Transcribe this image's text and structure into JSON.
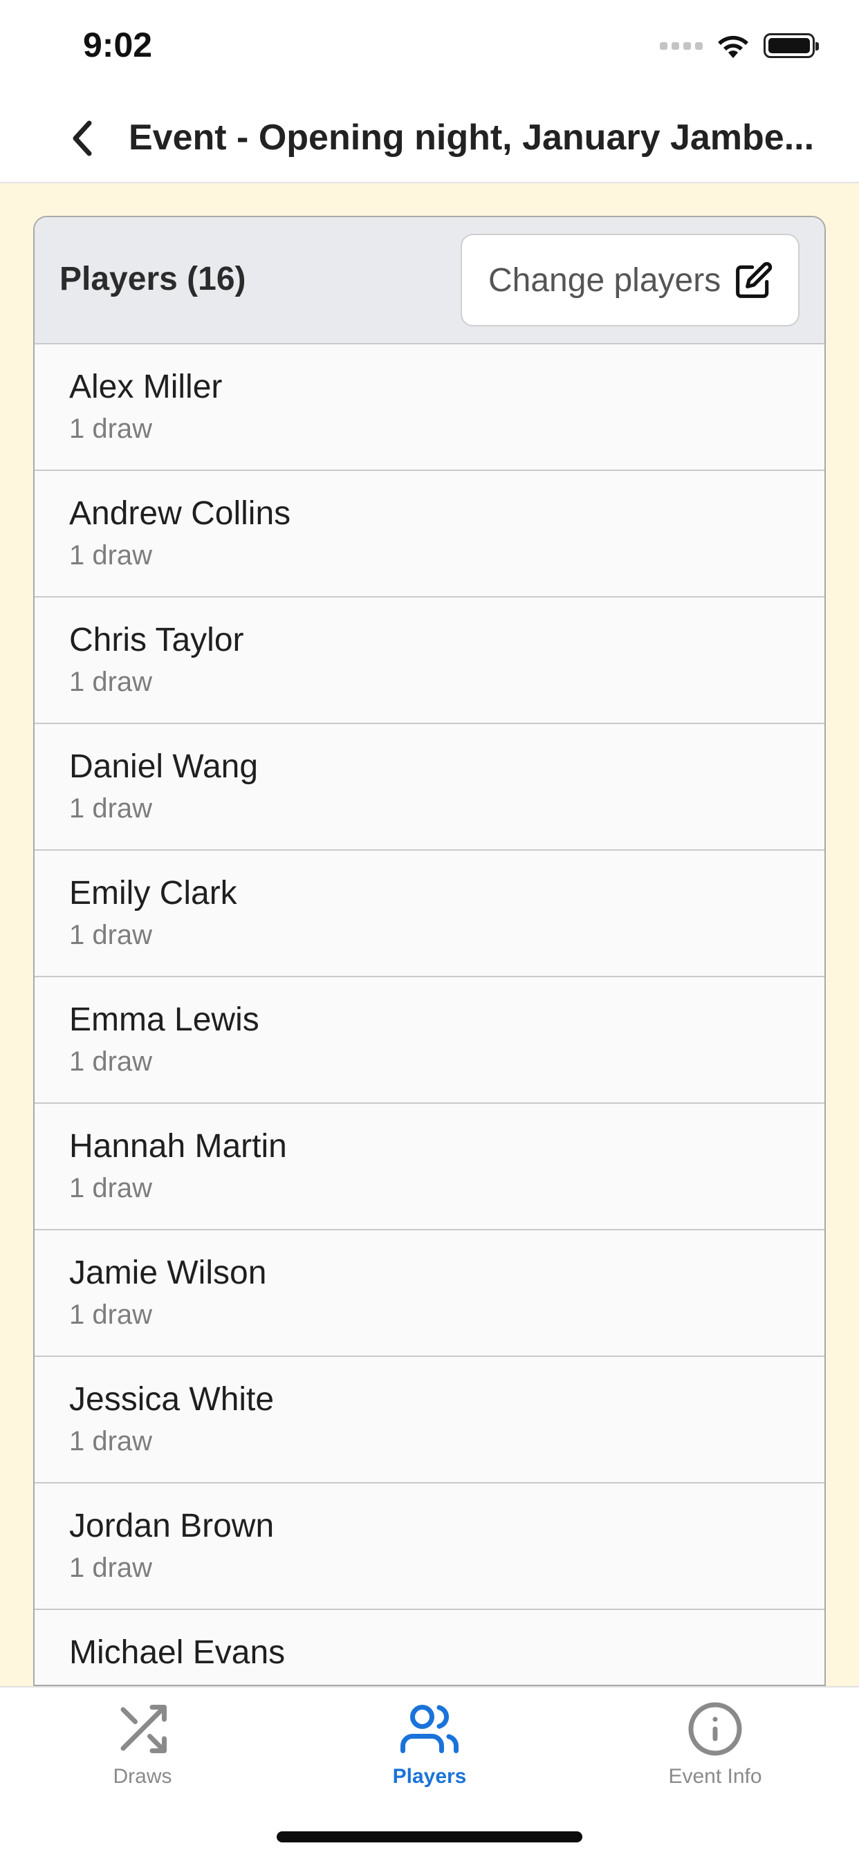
{
  "status_bar": {
    "time": "9:02"
  },
  "nav": {
    "title": "Event  -  Opening night, January Jambe..."
  },
  "players_card": {
    "title": "Players (16)",
    "change_players_label": "Change players"
  },
  "players": [
    {
      "name": "Alex Miller",
      "draws": "1 draw"
    },
    {
      "name": "Andrew Collins",
      "draws": "1 draw"
    },
    {
      "name": "Chris Taylor",
      "draws": "1 draw"
    },
    {
      "name": "Daniel Wang",
      "draws": "1 draw"
    },
    {
      "name": "Emily Clark",
      "draws": "1 draw"
    },
    {
      "name": "Emma Lewis",
      "draws": "1 draw"
    },
    {
      "name": "Hannah Martin",
      "draws": "1 draw"
    },
    {
      "name": "Jamie Wilson",
      "draws": "1 draw"
    },
    {
      "name": "Jessica White",
      "draws": "1 draw"
    },
    {
      "name": "Jordan Brown",
      "draws": "1 draw"
    },
    {
      "name": "Michael Evans",
      "draws": ""
    }
  ],
  "tabs": [
    {
      "label": "Draws",
      "icon": "shuffle-icon",
      "active": false
    },
    {
      "label": "Players",
      "icon": "users-icon",
      "active": true
    },
    {
      "label": "Event Info",
      "icon": "info-icon",
      "active": false
    }
  ],
  "colors": {
    "background": "#fff7dd",
    "active_tab": "#1a73d9",
    "inactive_tab": "#8a8a8a"
  }
}
